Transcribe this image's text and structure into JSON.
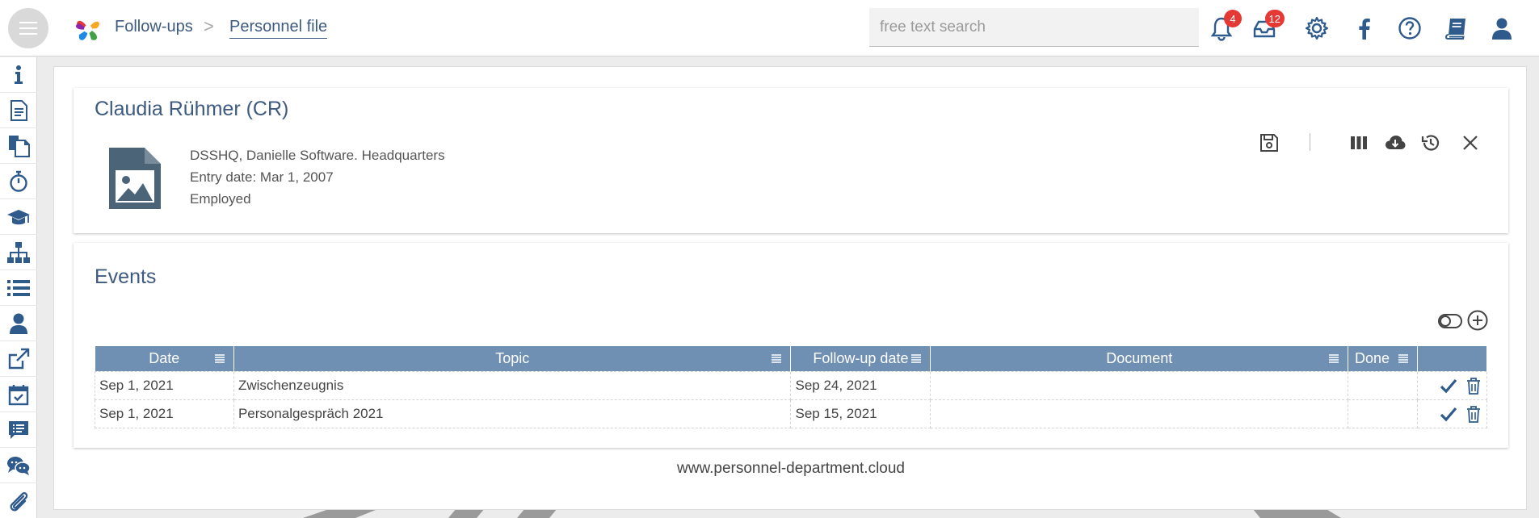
{
  "topbar": {
    "breadcrumb_root": "Follow-ups",
    "breadcrumb_separator": ">",
    "breadcrumb_current": "Personnel file",
    "search_placeholder": "free text search",
    "notifications_count": "4",
    "inbox_count": "12",
    "icons": [
      "menu-icon",
      "bell-icon",
      "inbox-icon",
      "gear-icon",
      "facebook-icon",
      "help-icon",
      "book-icon",
      "user-icon"
    ]
  },
  "sidebar": {
    "items": [
      "info-icon",
      "document-icon",
      "documents-icon",
      "stopwatch-icon",
      "graduation-cap-icon",
      "org-chart-icon",
      "list-icon",
      "person-icon",
      "external-link-icon",
      "calendar-check-icon",
      "comment-list-icon",
      "chat-icon",
      "paperclip-icon"
    ]
  },
  "person": {
    "name": "Claudia Rühmer (CR)",
    "company": "DSSHQ, Danielle Software. Headquarters",
    "entry_date": "Entry date: Mar 1, 2007",
    "status": "Employed"
  },
  "events": {
    "title": "Events",
    "columns": [
      "Date",
      "Topic",
      "Follow-up date",
      "Document",
      "Done",
      ""
    ],
    "rows": [
      {
        "date": "Sep 1, 2021",
        "topic": "Zwischenzeugnis",
        "followup": "Sep 24, 2021",
        "document": "",
        "done": ""
      },
      {
        "date": "Sep 1, 2021",
        "topic": "Personalgespräch 2021",
        "followup": "Sep 15, 2021",
        "document": "",
        "done": ""
      }
    ]
  },
  "footer": {
    "link": "www.personnel-department.cloud"
  },
  "colors": {
    "accent": "#3d5a80",
    "table_header": "#6f8fb3",
    "badge": "#e53935"
  }
}
